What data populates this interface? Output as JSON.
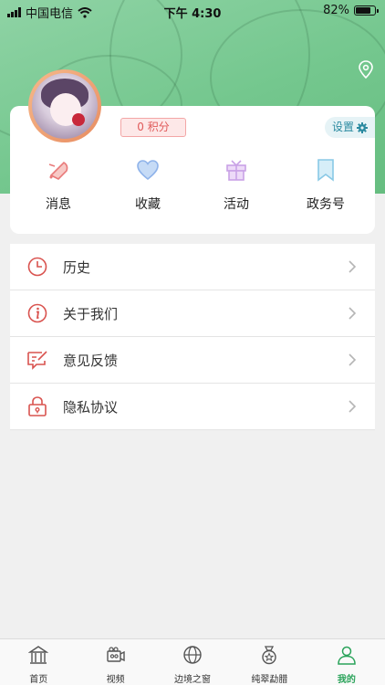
{
  "status_bar": {
    "carrier": "中国电信",
    "time": "下午 4:30",
    "battery": "82%",
    "battery_level": 0.82
  },
  "profile": {
    "points_label": "0 积分",
    "settings_label": "设置"
  },
  "quick_actions": [
    {
      "label": "消息",
      "icon": "message-icon",
      "color": "#e97a7a"
    },
    {
      "label": "收藏",
      "icon": "heart-icon",
      "color": "#8fb3ea"
    },
    {
      "label": "活动",
      "icon": "gift-icon",
      "color": "#c9a2e6"
    },
    {
      "label": "政务号",
      "icon": "bookmark-icon",
      "color": "#89c9e6"
    }
  ],
  "menu": [
    {
      "label": "历史",
      "icon": "clock-icon"
    },
    {
      "label": "关于我们",
      "icon": "info-icon"
    },
    {
      "label": "意见反馈",
      "icon": "feedback-icon"
    },
    {
      "label": "隐私协议",
      "icon": "lock-icon"
    }
  ],
  "tabs": [
    {
      "label": "首页",
      "icon": "home-icon",
      "active": false
    },
    {
      "label": "视频",
      "icon": "video-icon",
      "active": false
    },
    {
      "label": "边境之窗",
      "icon": "globe-icon",
      "active": false
    },
    {
      "label": "纯翠勐腊",
      "icon": "badge-icon",
      "active": false
    },
    {
      "label": "我的",
      "icon": "user-icon",
      "active": true
    }
  ],
  "colors": {
    "accent": "#2aa35a",
    "menu_icon": "#d9534f",
    "hero": "#74c78e"
  }
}
